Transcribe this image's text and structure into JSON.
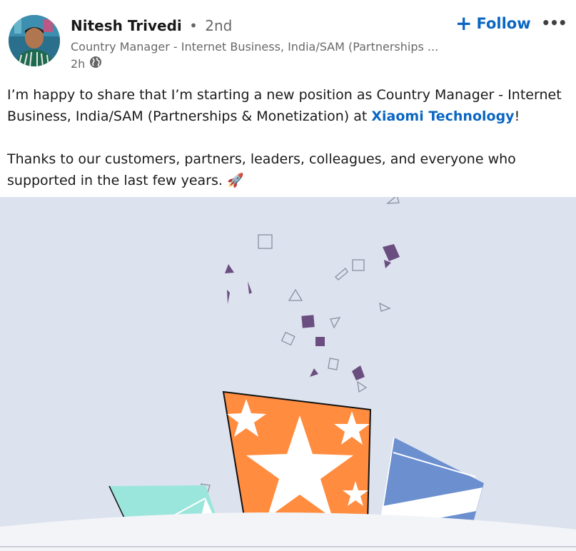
{
  "post": {
    "author": {
      "name": "Nitesh Trivedi",
      "separator": "•",
      "degree": "2nd",
      "headline": "Country Manager - Internet Business, India/SAM (Partnerships ...",
      "time": "2h",
      "visibility_icon": "globe-icon"
    },
    "actions": {
      "follow_label": "Follow",
      "follow_icon": "plus-icon",
      "more_label": "•••",
      "more_icon": "more-horizontal-icon"
    },
    "commentary": {
      "line1_before": "I’m happy to share that I’m starting a new position as Country Manager - Internet Business, India/SAM (Partnerships & Monetization) at ",
      "mention": "Xiaomi Technology",
      "line1_after": "!",
      "line2": "Thanks to our customers, partners, leaders, colleagues, and everyone who supported in the last few years. ",
      "emoji": "🚀"
    },
    "image": {
      "description_icon": "celebration-illustration",
      "colors": {
        "background": "#dde3ee",
        "orange": "#ff8c3f",
        "teal": "#9be6dc",
        "blue": "#6b8fcf",
        "confetti": "#6b4e80"
      }
    },
    "colors": {
      "link": "#0a66c2",
      "secondary_text": "#666666"
    }
  }
}
